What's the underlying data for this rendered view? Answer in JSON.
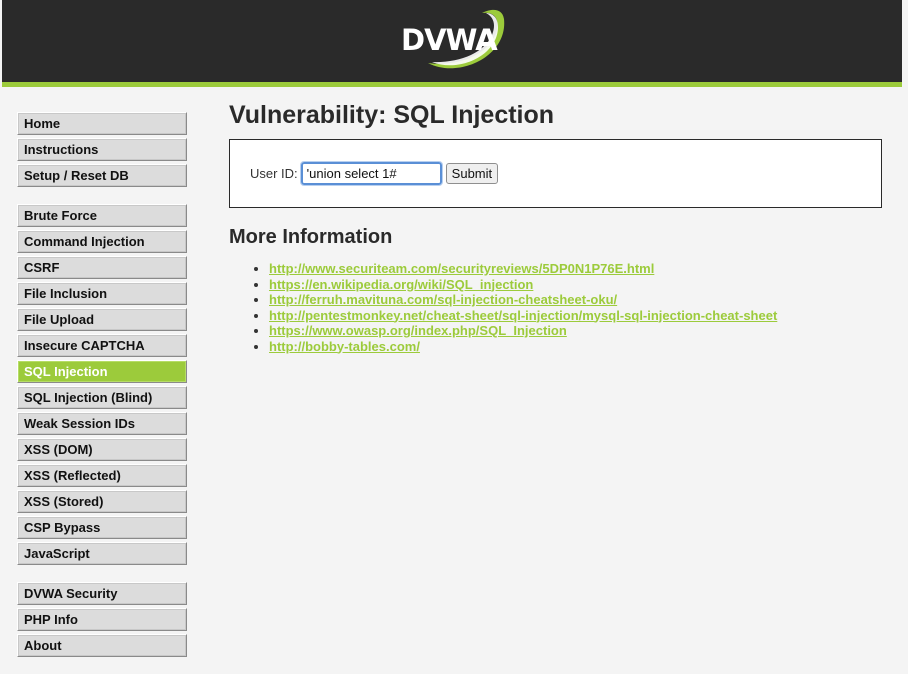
{
  "header": {
    "logo_text": "DVWA",
    "accent_color": "#9ccb3b",
    "background_color": "#2a2a2a"
  },
  "sidebar": {
    "groups": [
      {
        "items": [
          {
            "label": "Home"
          },
          {
            "label": "Instructions"
          },
          {
            "label": "Setup / Reset DB"
          }
        ]
      },
      {
        "items": [
          {
            "label": "Brute Force"
          },
          {
            "label": "Command Injection"
          },
          {
            "label": "CSRF"
          },
          {
            "label": "File Inclusion"
          },
          {
            "label": "File Upload"
          },
          {
            "label": "Insecure CAPTCHA"
          },
          {
            "label": "SQL Injection",
            "active": true
          },
          {
            "label": "SQL Injection (Blind)"
          },
          {
            "label": "Weak Session IDs"
          },
          {
            "label": "XSS (DOM)"
          },
          {
            "label": "XSS (Reflected)"
          },
          {
            "label": "XSS (Stored)"
          },
          {
            "label": "CSP Bypass"
          },
          {
            "label": "JavaScript"
          }
        ]
      },
      {
        "items": [
          {
            "label": "DVWA Security"
          },
          {
            "label": "PHP Info"
          },
          {
            "label": "About"
          }
        ]
      }
    ]
  },
  "main": {
    "title": "Vulnerability: SQL Injection",
    "form": {
      "userid_label": "User ID:",
      "userid_value": "'union select 1#",
      "submit_label": "Submit"
    },
    "more_info_title": "More Information",
    "links": [
      "http://www.securiteam.com/securityreviews/5DP0N1P76E.html",
      "https://en.wikipedia.org/wiki/SQL_injection",
      "http://ferruh.mavituna.com/sql-injection-cheatsheet-oku/",
      "http://pentestmonkey.net/cheat-sheet/sql-injection/mysql-sql-injection-cheat-sheet",
      "https://www.owasp.org/index.php/SQL_Injection",
      "http://bobby-tables.com/"
    ]
  }
}
